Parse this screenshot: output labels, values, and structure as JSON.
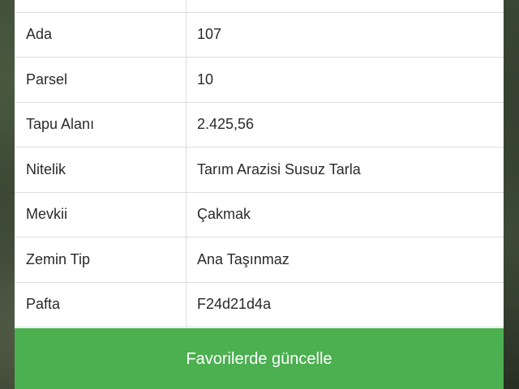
{
  "details": {
    "rows": [
      {
        "label": "",
        "value": ""
      },
      {
        "label": "Ada",
        "value": "107"
      },
      {
        "label": "Parsel",
        "value": "10"
      },
      {
        "label": "Tapu Alanı",
        "value": "2.425,56"
      },
      {
        "label": "Nitelik",
        "value": "Tarım Arazisi Susuz Tarla"
      },
      {
        "label": "Mevkii",
        "value": "Çakmak"
      },
      {
        "label": "Zemin Tip",
        "value": "Ana Taşınmaz"
      },
      {
        "label": "Pafta",
        "value": "F24d21d4a"
      }
    ]
  },
  "actions": {
    "update_favorites_label": "Favorilerde güncelle"
  },
  "colors": {
    "accent": "#4caf50"
  }
}
